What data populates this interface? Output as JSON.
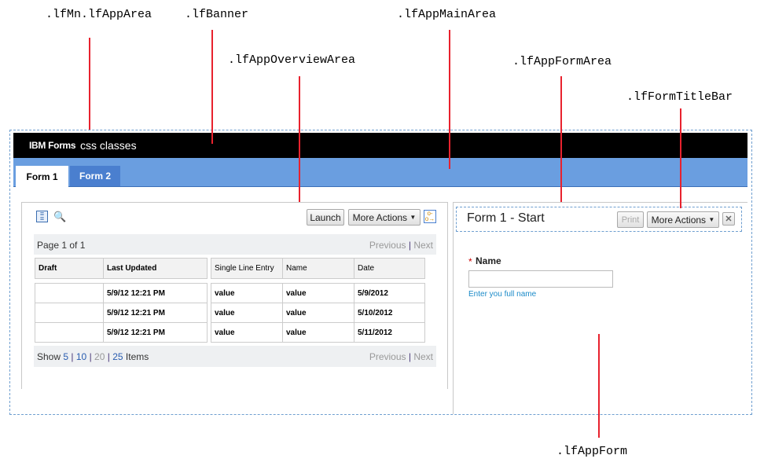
{
  "annotations": [
    ".lfMn.lfAppArea",
    ".lfBanner",
    ".lfAppMainArea",
    ".lfAppOverviewArea",
    ".lfAppFormArea",
    ".lfFormTitleBar",
    ".lfAppForm"
  ],
  "banner": {
    "brand": "IBM Forms",
    "title": "css classes"
  },
  "tabs": [
    "Form 1",
    "Form 2"
  ],
  "overview": {
    "launch": "Launch",
    "more_actions": "More Actions",
    "page_info": "Page 1 of 1",
    "previous": "Previous",
    "sep": "|",
    "next": "Next",
    "left_headers": [
      "Draft",
      "Last Updated"
    ],
    "right_headers": [
      "Single Line Entry",
      "Name",
      "Date"
    ],
    "rows": [
      {
        "draft": "",
        "updated": "5/9/12 12:21 PM",
        "single": "value",
        "name": "value",
        "date": "5/9/2012"
      },
      {
        "draft": "",
        "updated": "5/9/12 12:21 PM",
        "single": "value",
        "name": "value",
        "date": "5/10/2012"
      },
      {
        "draft": "",
        "updated": "5/9/12 12:21 PM",
        "single": "value",
        "name": "value",
        "date": "5/11/2012"
      }
    ],
    "show": "Show",
    "sizes": [
      "5",
      "10",
      "20",
      "25"
    ],
    "items": "Items"
  },
  "form": {
    "title": "Form 1 - Start",
    "print": "Print",
    "more_actions": "More Actions",
    "close": "✕",
    "required": "*",
    "field_label": "Name",
    "field_value": "",
    "hint": "Enter you full name"
  }
}
